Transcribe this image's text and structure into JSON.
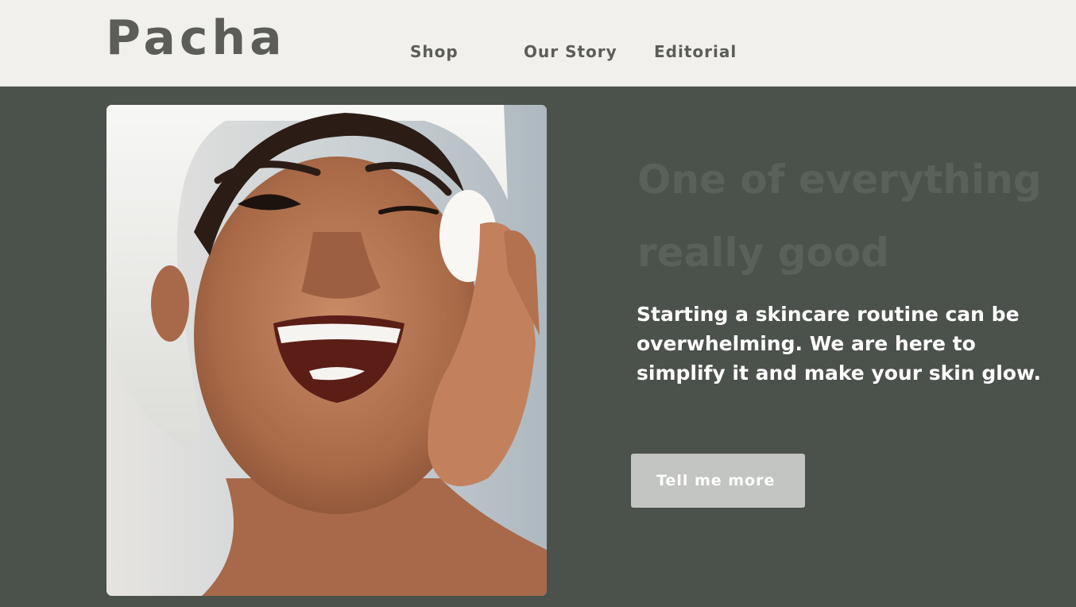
{
  "header": {
    "logo": "Pacha",
    "nav": [
      {
        "label": "Shop"
      },
      {
        "label": "Our Story"
      },
      {
        "label": "Editorial"
      }
    ]
  },
  "hero": {
    "headline": "One of everything really good",
    "subtext": "Starting a skincare routine can be overwhelming. We are here to simplify it and make your skin glow.",
    "cta_label": "Tell me more",
    "image_subject": "woman with towel on head smiling, applying cotton pad to face"
  },
  "colors": {
    "header_bg": "#f1f0ec",
    "page_bg": "#4b514b",
    "logo_text": "#5c5c58",
    "headline_text": "#5a605a",
    "body_text": "#ffffff",
    "button_bg": "#c3c5c2"
  }
}
